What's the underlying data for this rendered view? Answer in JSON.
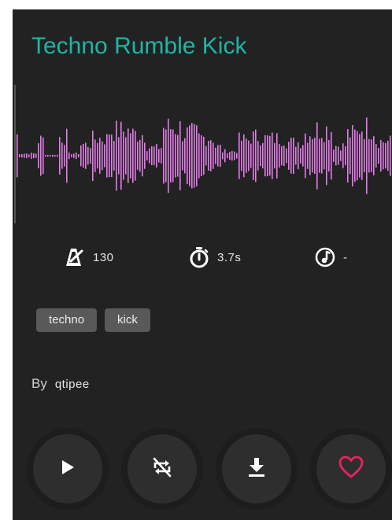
{
  "sound": {
    "title": "Techno Rumble Kick",
    "accent_color": "#1fb5a3",
    "waveform_color": "#e27ee8"
  },
  "stats": {
    "bpm_icon": "metronome-icon",
    "bpm": "130",
    "duration_icon": "stopwatch-icon",
    "duration": "3.7s",
    "key_icon": "music-note-icon",
    "key": "-"
  },
  "tags": [
    "techno",
    "kick"
  ],
  "author": {
    "by_label": "By",
    "username": "qtipee"
  },
  "controls": {
    "play_icon": "play-icon",
    "loop_icon": "loop-off-icon",
    "download_icon": "download-icon",
    "favorite_icon": "heart-icon",
    "favorite_color": "#e8245e"
  }
}
